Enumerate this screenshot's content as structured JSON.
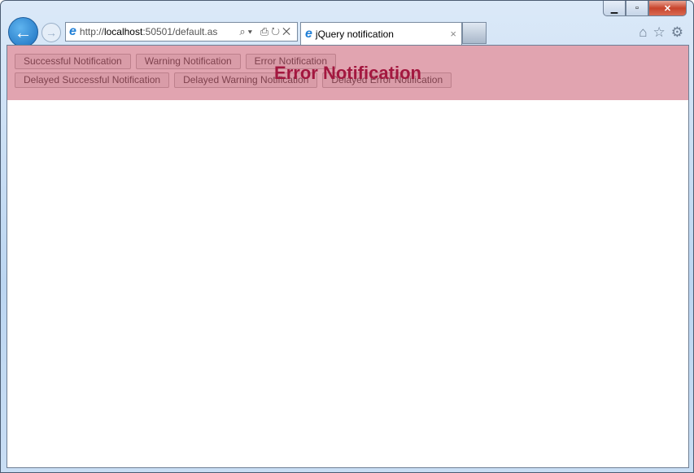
{
  "browser": {
    "url_prefix": "http://",
    "url_host": "localhost",
    "url_rest": ":50501/default.as",
    "tab_title": "jQuery notification",
    "address_tools": "⌕▾ ⎙↻✕",
    "tab_close": "×",
    "back": "←",
    "forward": "→",
    "min": "▁",
    "max": "▫",
    "close": "✕",
    "home": "⌂",
    "favorites": "☆",
    "settings": "⚙"
  },
  "page": {
    "buttons_row1": [
      "Successful Notification",
      "Warning Notification",
      "Error Notification"
    ],
    "buttons_row2": [
      "Delayed Successful Notification",
      "Delayed Warning Notification",
      "Delayed Error Notification"
    ],
    "notification": "Error Notification"
  }
}
